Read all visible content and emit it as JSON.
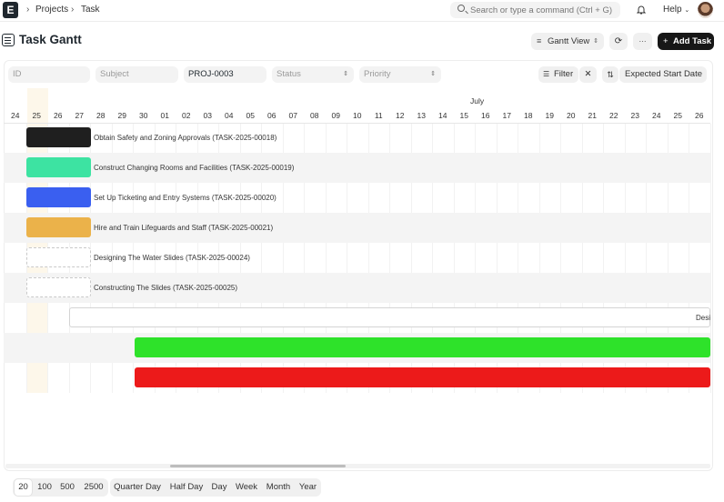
{
  "navbar": {
    "logo": "E",
    "breadcrumbs": [
      "Projects",
      "Task"
    ],
    "search_placeholder": "Search or type a command (Ctrl + G)",
    "help_label": "Help"
  },
  "page": {
    "title": "Task Gantt",
    "view_label": "Gantt View",
    "more_label": "···",
    "add_label": "Add Task"
  },
  "filters": {
    "id_placeholder": "ID",
    "subject_placeholder": "Subject",
    "project_value": "PROJ-0003",
    "status_placeholder": "Status",
    "priority_placeholder": "Priority",
    "filter_label": "Filter",
    "sort_label": "Expected Start Date"
  },
  "gantt": {
    "month": "July",
    "dates": [
      "24",
      "25",
      "26",
      "27",
      "28",
      "29",
      "30",
      "01",
      "02",
      "03",
      "04",
      "05",
      "06",
      "07",
      "08",
      "09",
      "10",
      "11",
      "12",
      "13",
      "14",
      "15",
      "16",
      "17",
      "18",
      "19",
      "20",
      "21",
      "22",
      "23",
      "24",
      "25",
      "26"
    ],
    "tasks": [
      {
        "label": "Obtain Safety and Zoning Approvals (TASK-2025-00018)",
        "color": "#1f1f1f"
      },
      {
        "label": "Construct Changing Rooms and Facilities (TASK-2025-00019)",
        "color": "#3de3a2"
      },
      {
        "label": "Set Up Ticketing and Entry Systems (TASK-2025-00020)",
        "color": "#3a5ff0"
      },
      {
        "label": "Hire and Train Lifeguards and Staff (TASK-2025-00021)",
        "color": "#ebb24a"
      },
      {
        "label": "Designing The Water Slides (TASK-2025-00024)",
        "color": "#ffffff"
      },
      {
        "label": "Constructing The Slides (TASK-2025-00025)",
        "color": "#ffffff"
      },
      {
        "label": "Desi",
        "color": "#ffffff"
      },
      {
        "label": "",
        "color": "#2ee22a"
      },
      {
        "label": "",
        "color": "#ec1a1a"
      }
    ]
  },
  "bottom": {
    "page_sizes": [
      "20",
      "100",
      "500",
      "2500"
    ],
    "scales": [
      "Quarter Day",
      "Half Day",
      "Day",
      "Week",
      "Month",
      "Year"
    ]
  }
}
